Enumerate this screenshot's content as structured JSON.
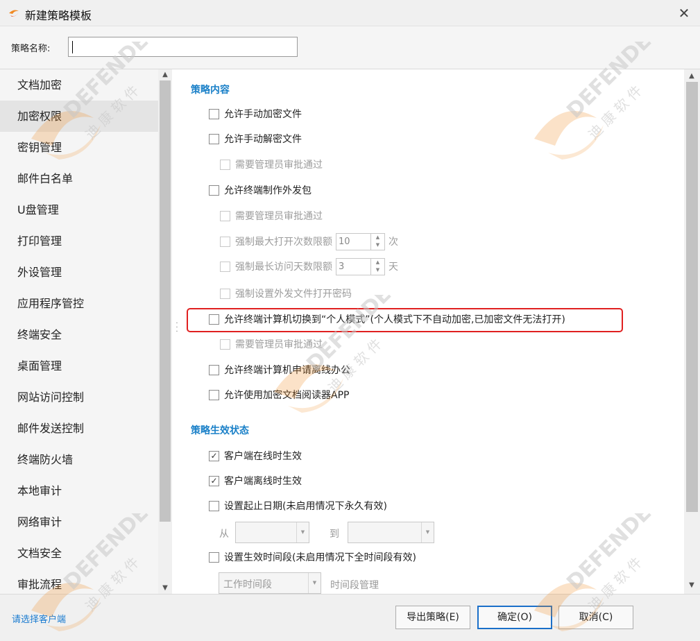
{
  "window": {
    "title": "新建策略模板",
    "close_glyph": "✕"
  },
  "name_field": {
    "label": "策略名称:",
    "value": ""
  },
  "sidebar": {
    "items": [
      {
        "label": "文档加密"
      },
      {
        "label": "加密权限",
        "selected": true
      },
      {
        "label": "密钥管理"
      },
      {
        "label": "邮件白名单"
      },
      {
        "label": "U盘管理"
      },
      {
        "label": "打印管理"
      },
      {
        "label": "外设管理"
      },
      {
        "label": "应用程序管控"
      },
      {
        "label": "终端安全"
      },
      {
        "label": "桌面管理"
      },
      {
        "label": "网站访问控制"
      },
      {
        "label": "邮件发送控制"
      },
      {
        "label": "终端防火墙"
      },
      {
        "label": "本地审计"
      },
      {
        "label": "网络审计"
      },
      {
        "label": "文档安全"
      },
      {
        "label": "审批流程"
      }
    ]
  },
  "content": {
    "section1_title": "策略内容",
    "opt_manual_encrypt": "允许手动加密文件",
    "opt_manual_decrypt": "允许手动解密文件",
    "opt_admin_approve_1": "需要管理员审批通过",
    "opt_outgoing_pkg": "允许终端制作外发包",
    "opt_admin_approve_2": "需要管理员审批通过",
    "opt_max_open_label": "强制最大打开次数限额",
    "opt_max_open_value": "10",
    "opt_max_open_unit": "次",
    "opt_max_days_label": "强制最长访问天数限额",
    "opt_max_days_value": "3",
    "opt_max_days_unit": "天",
    "opt_force_password": "强制设置外发文件打开密码",
    "opt_personal_mode": "允许终端计算机切换到“个人模式”(个人模式下不自动加密,已加密文件无法打开)",
    "opt_admin_approve_3": "需要管理员审批通过",
    "opt_offline_office": "允许终端计算机申请离线办公",
    "opt_reader_app": "允许使用加密文档阅读器APP",
    "section2_title": "策略生效状态",
    "opt_online_effective": "客户端在线时生效",
    "opt_offline_effective": "客户端离线时生效",
    "opt_date_range": "设置起止日期(未启用情况下永久有效)",
    "from_label": "从",
    "to_label": "到",
    "opt_time_period": "设置生效时间段(未启用情况下全时间段有效)",
    "time_period_value": "工作时间段",
    "time_period_manage": "时间段管理"
  },
  "checks": {
    "online_effective": true,
    "offline_effective": true
  },
  "footer": {
    "select_client": "请选择客户端",
    "export_btn": "导出策略(E)",
    "ok_btn": "确定(O)",
    "cancel_btn": "取消(C)"
  },
  "colors": {
    "accent": "#1a80c8",
    "highlight_border": "#e02020",
    "watermark": "#f08a24"
  },
  "watermark_text": {
    "brand": "DEFENDER",
    "cn": "迪 康 软 件"
  }
}
